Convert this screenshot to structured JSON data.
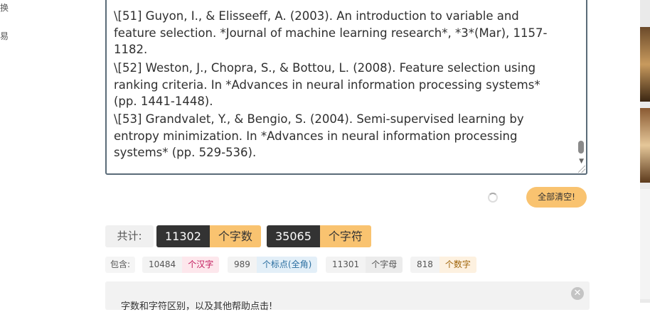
{
  "nav": {
    "item1": "换",
    "item2": "易"
  },
  "editor": {
    "references": [
      "\\[51] Guyon, I., & Elisseeff, A. (2003). An introduction to variable and feature selection. *Journal of machine learning research*, *3*(Mar), 1157-1182.",
      "\\[52] Weston, J., Chopra, S., & Bottou, L. (2008). Feature selection using ranking criteria. In *Advances in neural information processing systems* (pp. 1441-1448).",
      "\\[53] Grandvalet, Y., & Bengio, S. (2004). Semi-supervised learning by entropy minimization. In *Advances in neural information processing systems* (pp. 529-536)."
    ]
  },
  "actions": {
    "clear_all": "全部清空!"
  },
  "totals": {
    "label": "共计:",
    "words": {
      "value": "11302",
      "unit": "个字数"
    },
    "chars": {
      "value": "35065",
      "unit": "个字符"
    }
  },
  "breakdown": {
    "label": "包含:",
    "items": [
      {
        "value": "10484",
        "unit": "个汉字",
        "color": "#c2185b",
        "bg": "#fde7ec"
      },
      {
        "value": "989",
        "unit": "个标点(全角)",
        "color": "#2a6ea0",
        "bg": "#e3eff8"
      },
      {
        "value": "11301",
        "unit": "个字母",
        "color": "#555555",
        "bg": "#ececec"
      },
      {
        "value": "818",
        "unit": "个数字",
        "color": "#a0650a",
        "bg": "#fdf1e0"
      }
    ]
  },
  "info_panel": {
    "text": "字数和字符区别，以及其他帮助点击!"
  },
  "colors": {
    "accent": "#f9c370",
    "dark": "#333333"
  }
}
